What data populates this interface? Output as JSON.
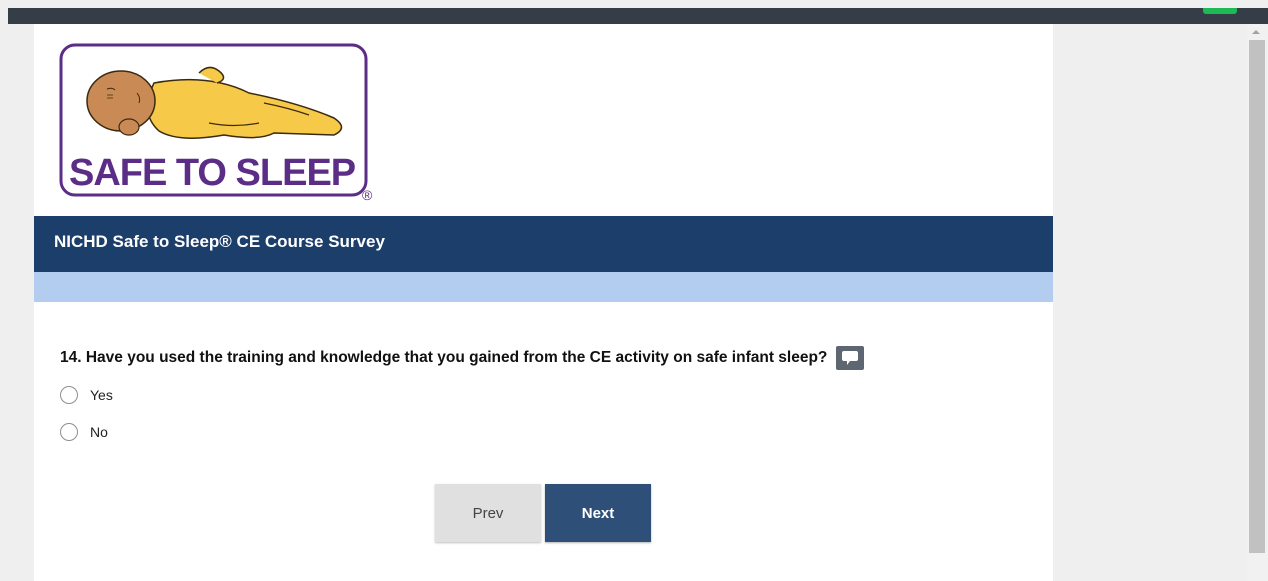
{
  "logo": {
    "text": "SAFE TO SLEEP",
    "registered": "®"
  },
  "survey": {
    "title": "NICHD Safe to Sleep® CE Course Survey"
  },
  "question": {
    "text": "14. Have you used the training and knowledge that you gained from the CE activity on safe infant sleep?",
    "options": [
      {
        "label": "Yes",
        "selected": false
      },
      {
        "label": "No",
        "selected": false
      }
    ]
  },
  "nav": {
    "prev_label": "Prev",
    "next_label": "Next"
  },
  "colors": {
    "header": "#1c3e6b",
    "progress_band": "#b3cdf0",
    "next_button": "#2d4f78",
    "prev_button": "#e0e0e0",
    "logo_purple": "#5b2d86",
    "baby_yellow": "#f7c948"
  }
}
